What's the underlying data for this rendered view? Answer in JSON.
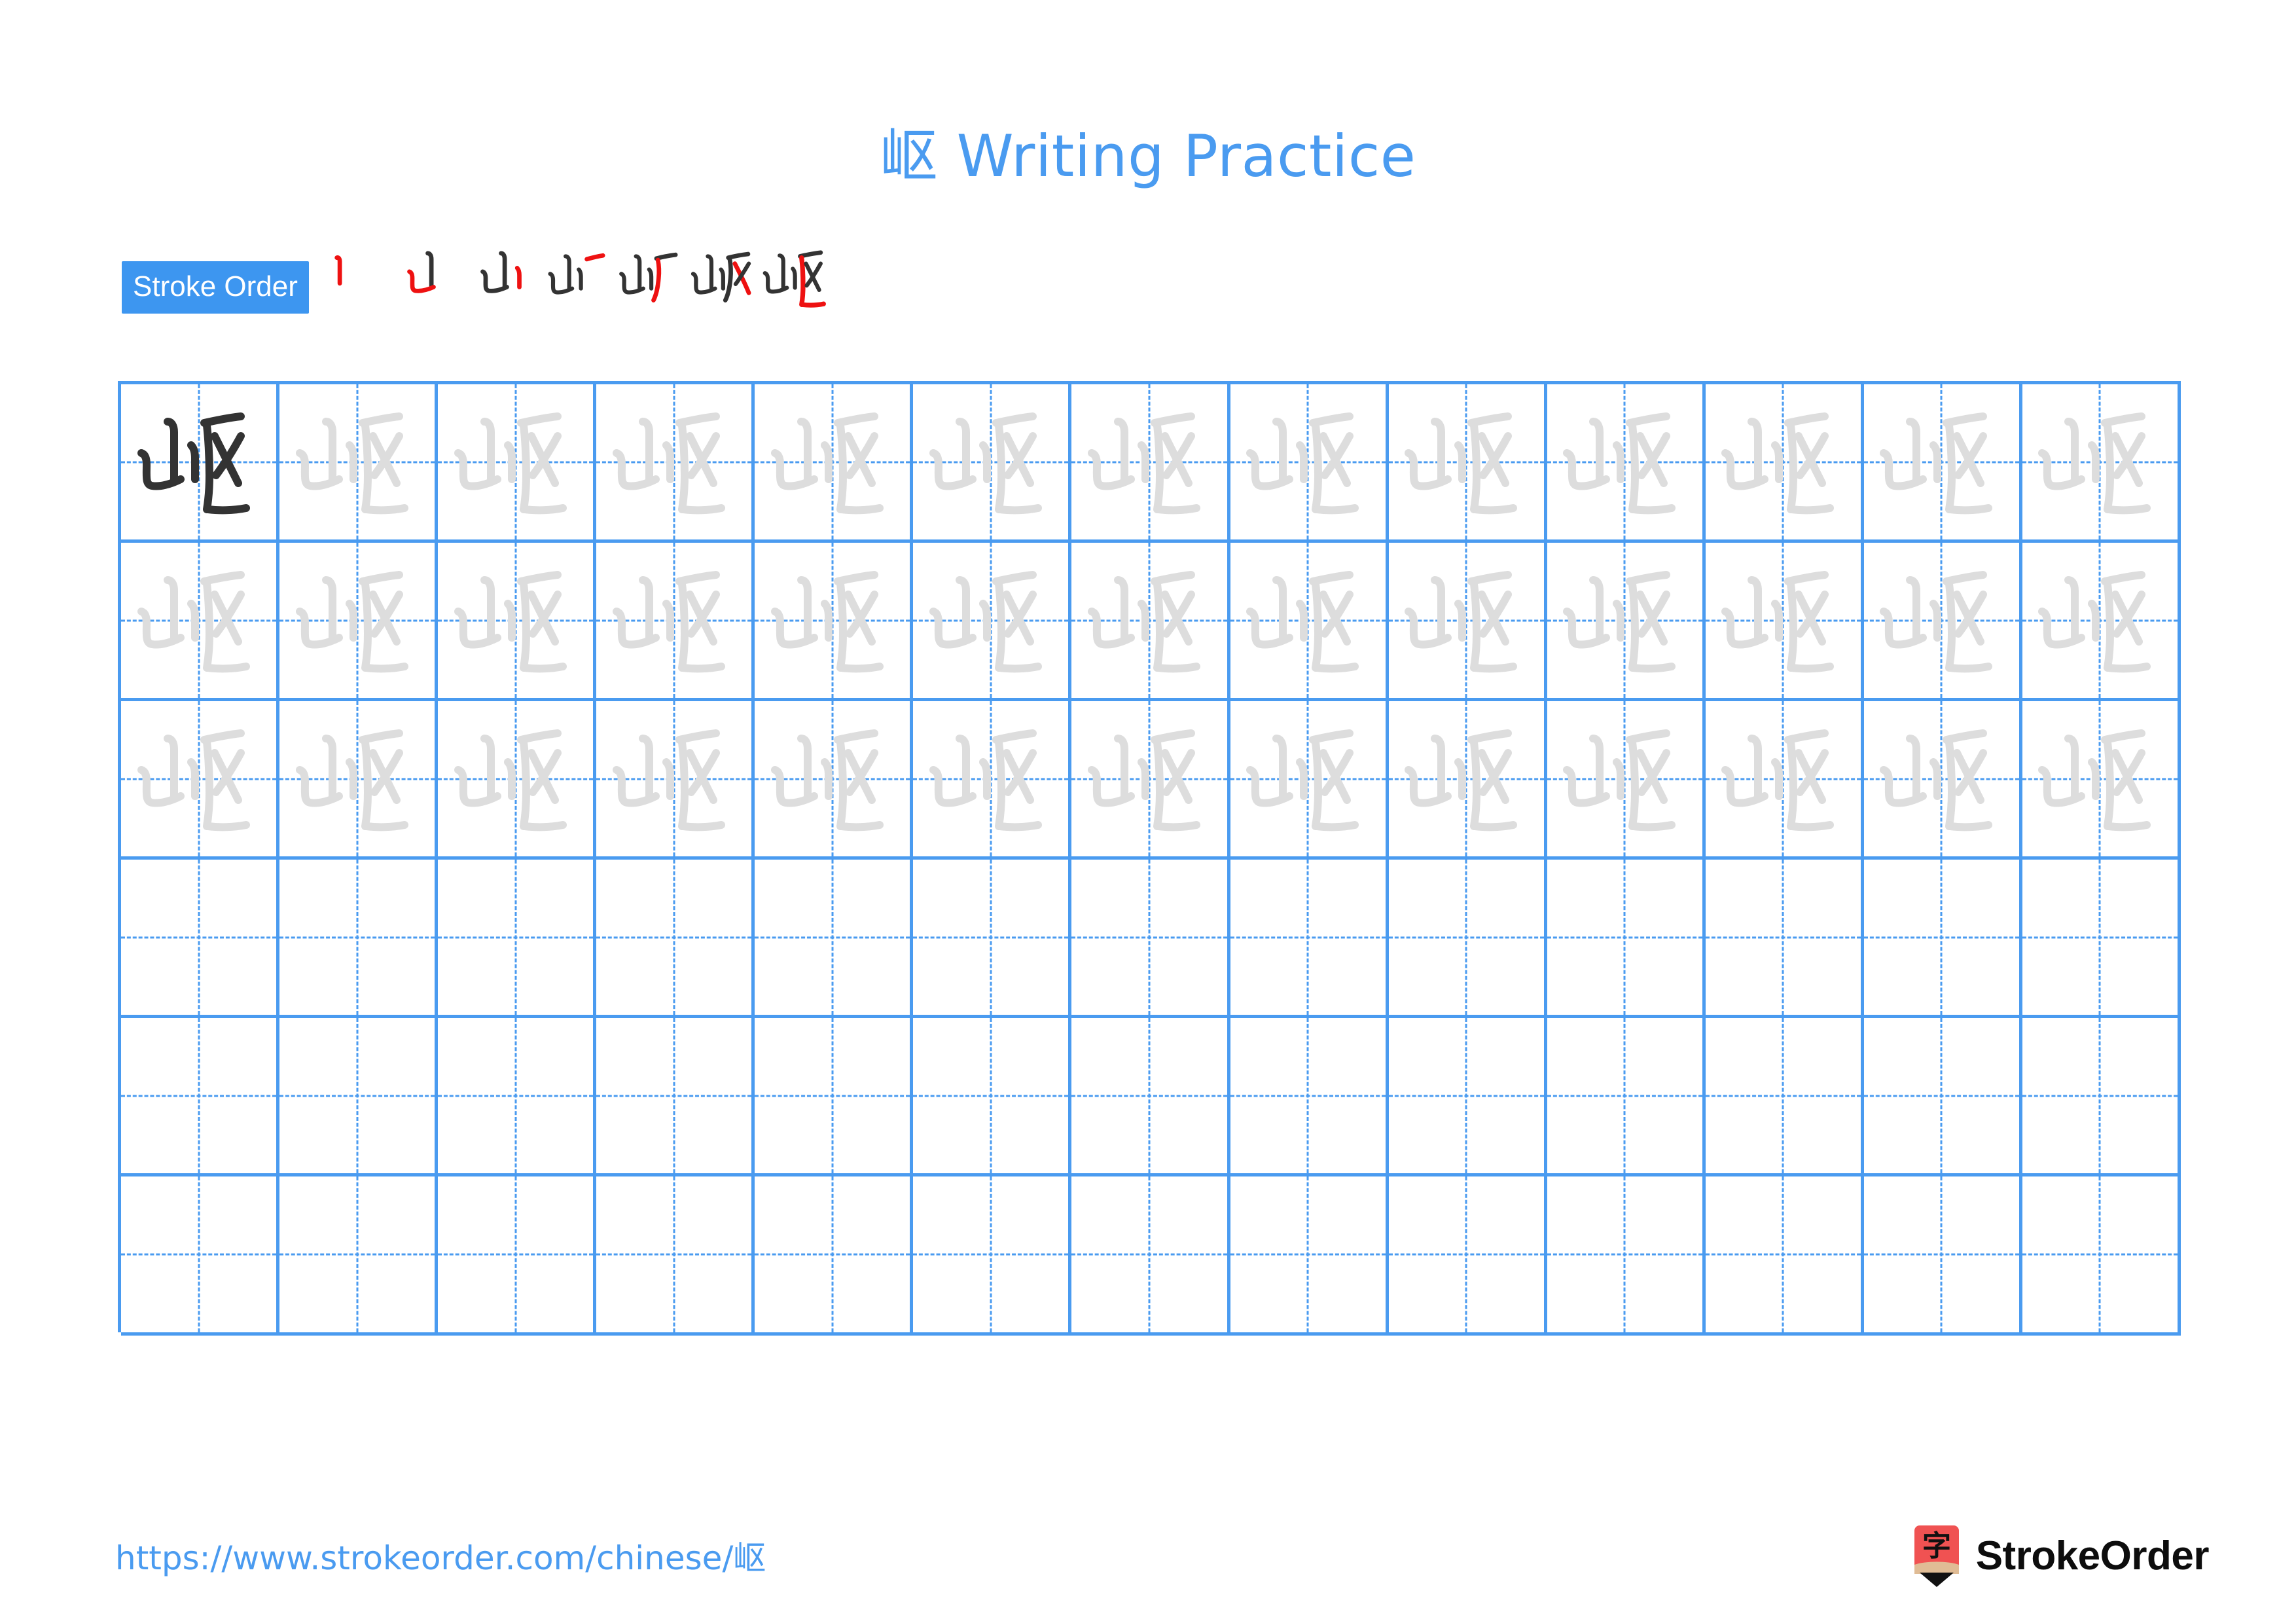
{
  "document": {
    "character": "岖",
    "title": "岖 Writing Practice",
    "title_suffix": "Writing Practice"
  },
  "stroke_order": {
    "label": "Stroke Order",
    "badge_bg": "#3d96f0",
    "badge_text_color": "#ffffff",
    "total_strokes": 7,
    "new_stroke_color": "#ee1111",
    "prior_stroke_color": "#333333",
    "steps": [
      {
        "index": 1,
        "strokes_shown": 1,
        "new_stroke_index": 1
      },
      {
        "index": 2,
        "strokes_shown": 2,
        "new_stroke_index": 2
      },
      {
        "index": 3,
        "strokes_shown": 3,
        "new_stroke_index": 3
      },
      {
        "index": 4,
        "strokes_shown": 4,
        "new_stroke_index": 4
      },
      {
        "index": 5,
        "strokes_shown": 5,
        "new_stroke_index": 5
      },
      {
        "index": 6,
        "strokes_shown": 6,
        "new_stroke_index": 6
      },
      {
        "index": 7,
        "strokes_shown": 7,
        "new_stroke_index": 7
      }
    ]
  },
  "practice_grid": {
    "columns": 13,
    "rows": 6,
    "grid_line_color": "#4a9bf0",
    "guide_line_color": "#4a9bf0",
    "solid_character_color": "#333333",
    "trace_character_color": "#dddddd",
    "row_fill": [
      "solid-then-trace",
      "trace",
      "trace",
      "empty",
      "empty",
      "empty"
    ]
  },
  "footer": {
    "url": "https://www.strokeorder.com/chinese/岖",
    "url_color": "#4a9bf0",
    "brand_name": "StrokeOrder",
    "logo_character": "字",
    "logo_body_color": "#f05252",
    "logo_wood_color": "#e0bc95",
    "logo_tip_color": "#111111"
  }
}
